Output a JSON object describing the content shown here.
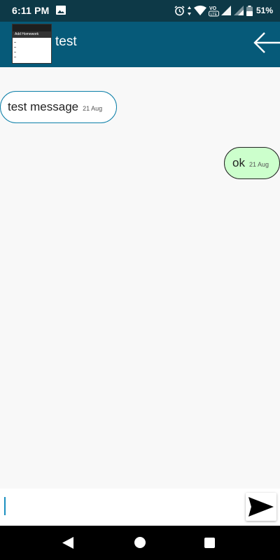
{
  "status_bar": {
    "time": "6:11 PM",
    "battery": "51%",
    "icons": [
      "gallery-icon",
      "alarm-icon",
      "data-arrows-icon",
      "wifi-icon",
      "volte-icon",
      "signal-icon",
      "signal-2-icon",
      "battery-icon"
    ]
  },
  "header": {
    "title": "test",
    "avatar_caption": "Add Homework",
    "back_icon": "arrow-left-icon",
    "color": "#065a79"
  },
  "messages": [
    {
      "direction": "incoming",
      "text": "test message",
      "time": "21 Aug",
      "bubble_color": "#ffffff",
      "border_color": "#0c7fa8"
    },
    {
      "direction": "outgoing",
      "text": "ok",
      "time": "21 Aug",
      "bubble_color": "#ccffcc",
      "border_color": "#222222"
    }
  ],
  "composer": {
    "value": "",
    "placeholder": "",
    "send_icon": "send-icon"
  },
  "nav_bar": {
    "icons": [
      "nav-back-icon",
      "nav-home-icon",
      "nav-recents-icon"
    ]
  }
}
